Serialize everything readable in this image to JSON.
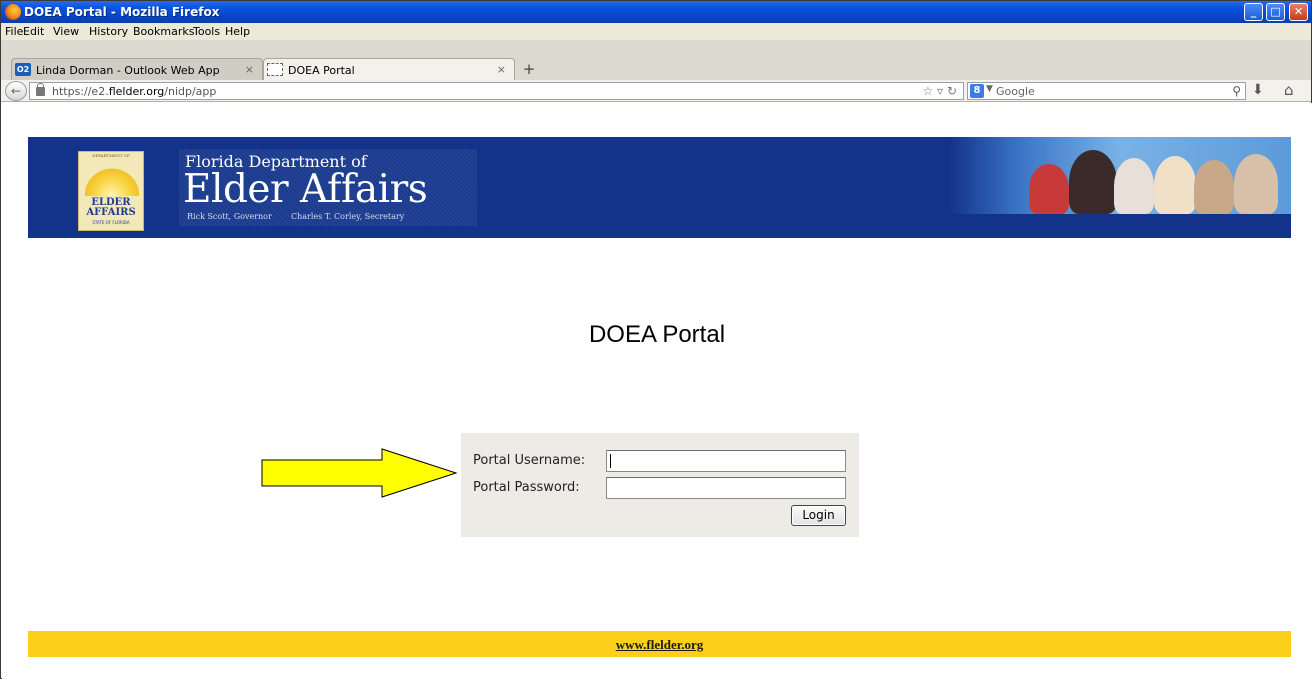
{
  "window": {
    "title": "DOEA Portal - Mozilla Firefox",
    "controls": {
      "minimize": "_",
      "maximize": "□",
      "close": "✕"
    }
  },
  "menu": [
    "File",
    "Edit",
    "View",
    "History",
    "Bookmarks",
    "Tools",
    "Help"
  ],
  "tabs": [
    {
      "label": "Linda Dorman - Outlook Web App",
      "icon": "O2",
      "close": "×"
    },
    {
      "label": "DOEA Portal",
      "close": "×"
    }
  ],
  "new_tab": "+",
  "nav": {
    "url_prefix": "https://e2.",
    "url_domain": "flelder.org",
    "url_path": "/nidp/app",
    "search_engine": "8",
    "search_placeholder": "Google"
  },
  "header": {
    "logo_top": "DEPARTMENT OF",
    "logo_line1": "ELDER",
    "logo_line2": "AFFAIRS",
    "logo_bottom": "STATE OF FLORIDA",
    "title_line1": "Florida Department of",
    "title_line2": "Elder Affairs",
    "governor": "Rick Scott, Governor",
    "secretary": "Charles T. Corley, Secretary"
  },
  "main": {
    "heading": "DOEA Portal",
    "username_label": "Portal  Username:",
    "password_label": "Portal  Password:",
    "username_value": "",
    "password_value": "",
    "login_button": "Login"
  },
  "footer": {
    "link": "www.flelder.org"
  },
  "colors": {
    "header_bg": "#13338a",
    "footer_bg": "#fccf1b",
    "arrow_fill": "#ffff00",
    "login_box_bg": "#ecebe6"
  }
}
